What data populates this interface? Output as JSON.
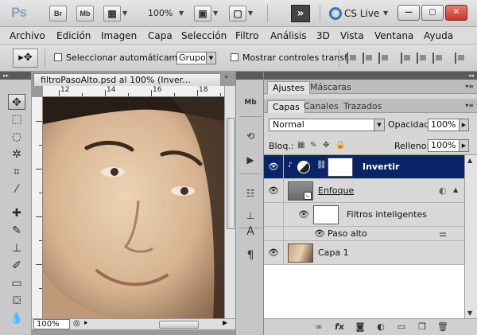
{
  "app": {
    "logo": "Ps",
    "bridge_btn": "Br",
    "minibridge_btn": "Mb",
    "zoom": "100%",
    "extension_btn": "»",
    "cs_live": "CS Live",
    "window_buttons": {
      "minimize": "—",
      "restore": "▢",
      "close": "✕"
    }
  },
  "menu": [
    "Archivo",
    "Edición",
    "Imagen",
    "Capa",
    "Selección",
    "Filtro",
    "Análisis",
    "3D",
    "Vista",
    "Ventana",
    "Ayuda"
  ],
  "options": {
    "auto_select_label": "Seleccionar automáticamente:",
    "auto_select_value": "Grupo",
    "transform_label": "Mostrar controles transf."
  },
  "document": {
    "tab_title": "filtroPasoAlto.psd al 100% (Inver...",
    "close": "«",
    "ruler_marks": [
      "12",
      "14",
      "16",
      "18"
    ],
    "zoom_field": "100%"
  },
  "panel": {
    "top_tabs": [
      "Ajustes",
      "Máscaras"
    ],
    "tabs": [
      "Capas",
      "Canales",
      "Trazados"
    ],
    "blend_mode": "Normal",
    "opacity_label": "Opacidad:",
    "opacity_value": "100%",
    "lock_label": "Bloq.:",
    "fill_label": "Relleno:",
    "fill_value": "100%",
    "layers": [
      {
        "name": "Invertir",
        "selected": true
      },
      {
        "name": "Enfoque",
        "selected": false
      },
      {
        "name": "Filtros inteligentes",
        "selected": false
      },
      {
        "name": "Paso alto",
        "selected": false
      },
      {
        "name": "Capa 1",
        "selected": false
      }
    ]
  },
  "icons": {
    "tools": [
      "move-icon",
      "marquee-icon",
      "lasso-icon",
      "quick-select-icon",
      "crop-icon",
      "eyedropper-icon",
      "healing-icon",
      "brush-icon",
      "stamp-icon",
      "history-brush-icon",
      "eraser-icon",
      "bucket-icon",
      "blur-icon"
    ],
    "strip": [
      "mini-bridge-icon",
      "history-icon",
      "actions-icon",
      "tool-presets-icon",
      "clone-source-icon",
      "character-icon",
      "paragraph-icon"
    ]
  }
}
